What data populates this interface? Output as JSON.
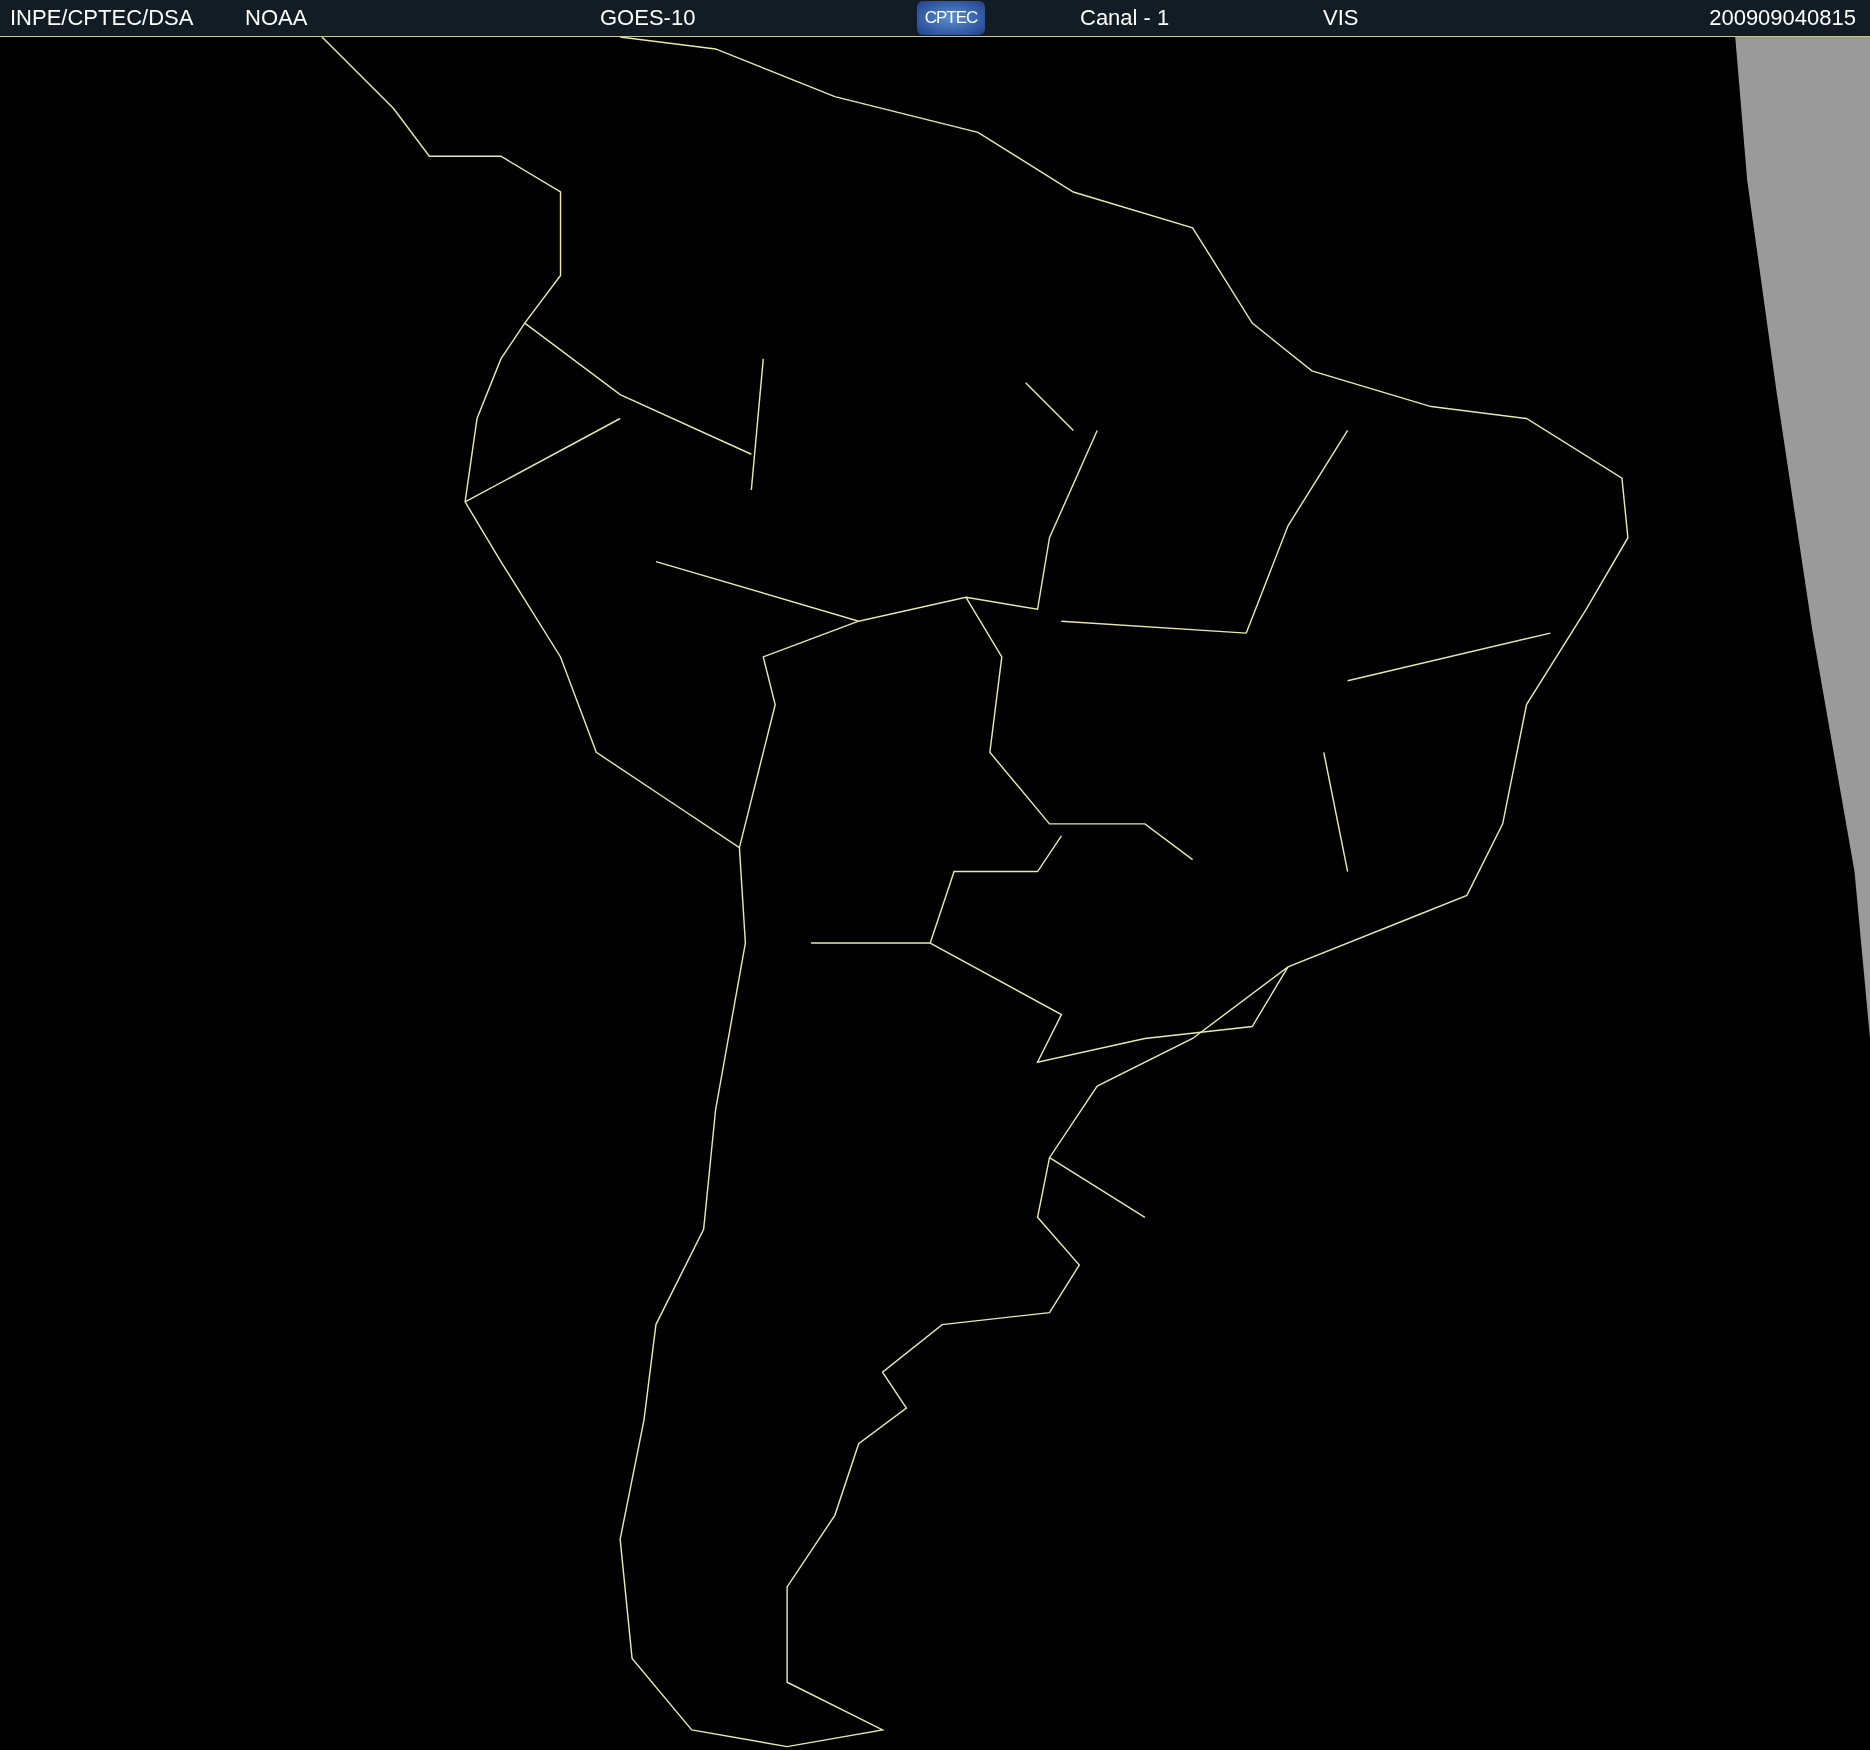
{
  "header": {
    "source": "INPE/CPTEC/DSA",
    "agency": "NOAA",
    "satellite": "GOES-10",
    "logo_text": "CPTEC",
    "channel": "Canal - 1",
    "band": "VIS",
    "timestamp": "200909040815"
  }
}
